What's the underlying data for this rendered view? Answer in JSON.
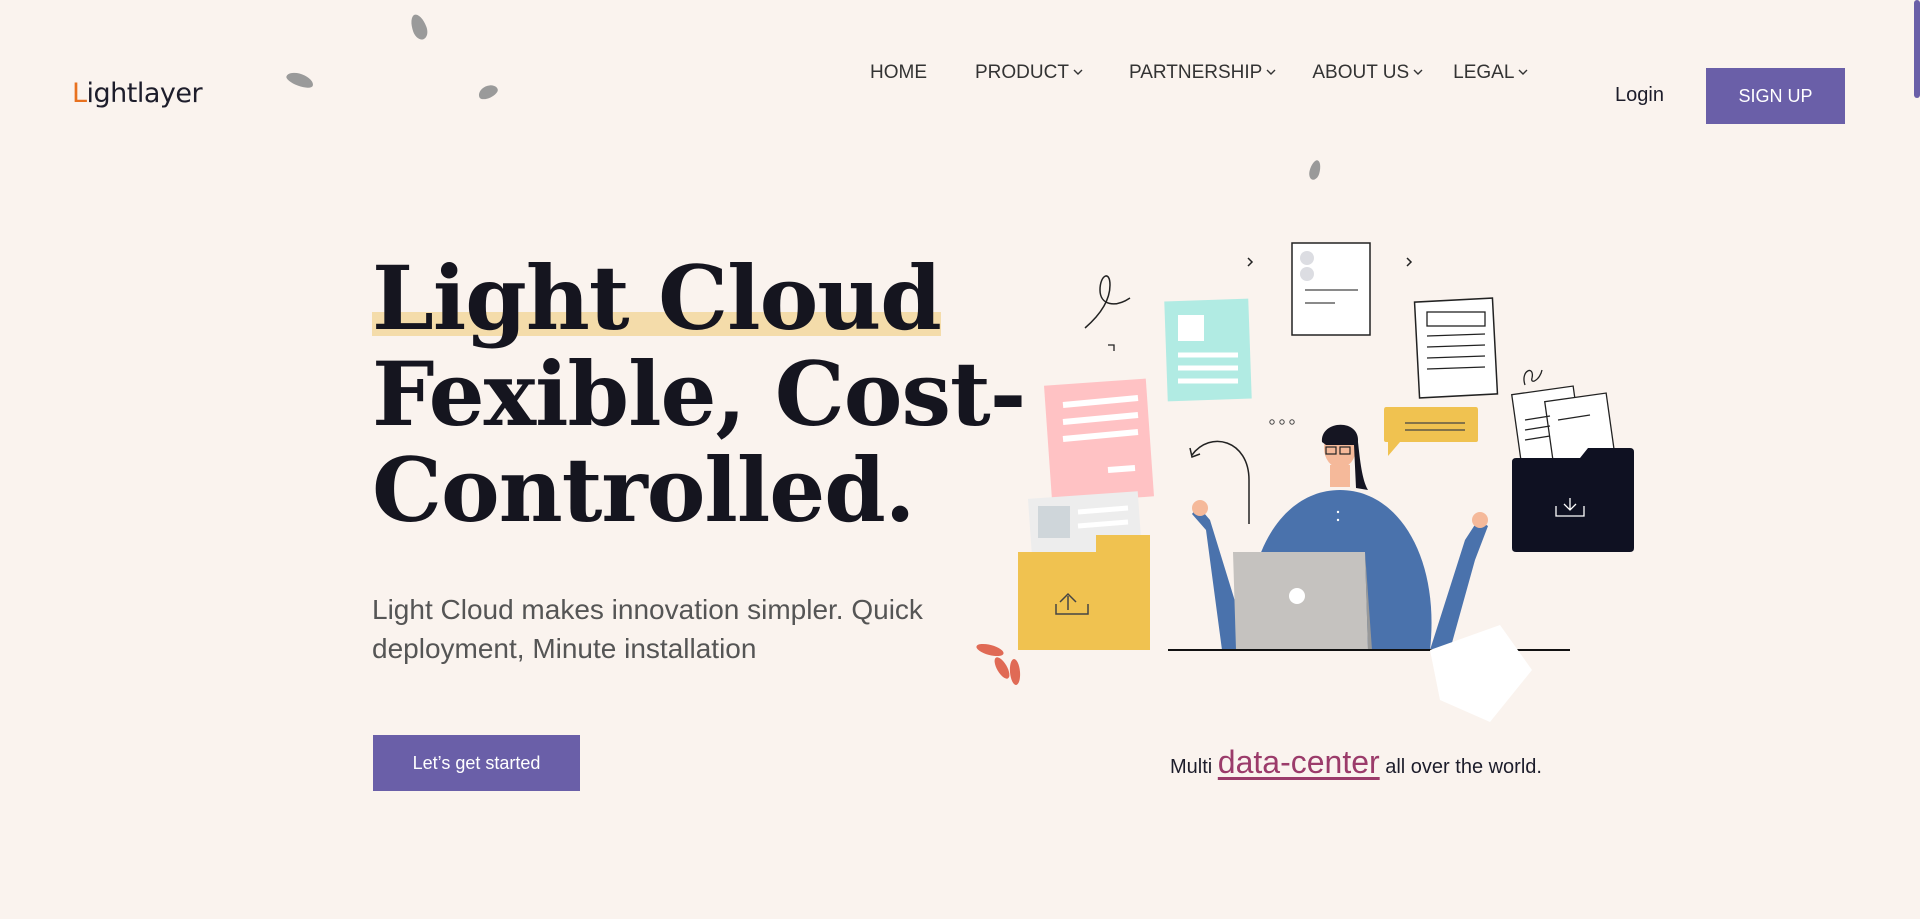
{
  "brand": {
    "logo_prefix": "L",
    "logo_rest": "ightlayer"
  },
  "nav": {
    "items": [
      {
        "label": "HOME",
        "has_dropdown": false
      },
      {
        "label": "PRODUCT",
        "has_dropdown": true
      },
      {
        "label": "PARTNERSHIP",
        "has_dropdown": true
      },
      {
        "label": "ABOUT US",
        "has_dropdown": true
      },
      {
        "label": "LEGAL",
        "has_dropdown": true
      }
    ],
    "login_label": "Login",
    "signup_label": "SIGN UP"
  },
  "hero": {
    "title_line1": "Light Cloud",
    "title_line2": "Fexible, Cost-",
    "title_line3": "Controlled.",
    "subtitle": "Light Cloud makes innovation simpler. Quick deployment, Minute installation",
    "cta_label": "Let’s get started"
  },
  "tagline": {
    "prefix": "Multi ",
    "link": "data-center",
    "suffix": " all over the world."
  },
  "colors": {
    "background": "#faf3ee",
    "accent": "#6a5fa8",
    "highlight": "#f4dcaa",
    "link": "#9b3b6a"
  }
}
